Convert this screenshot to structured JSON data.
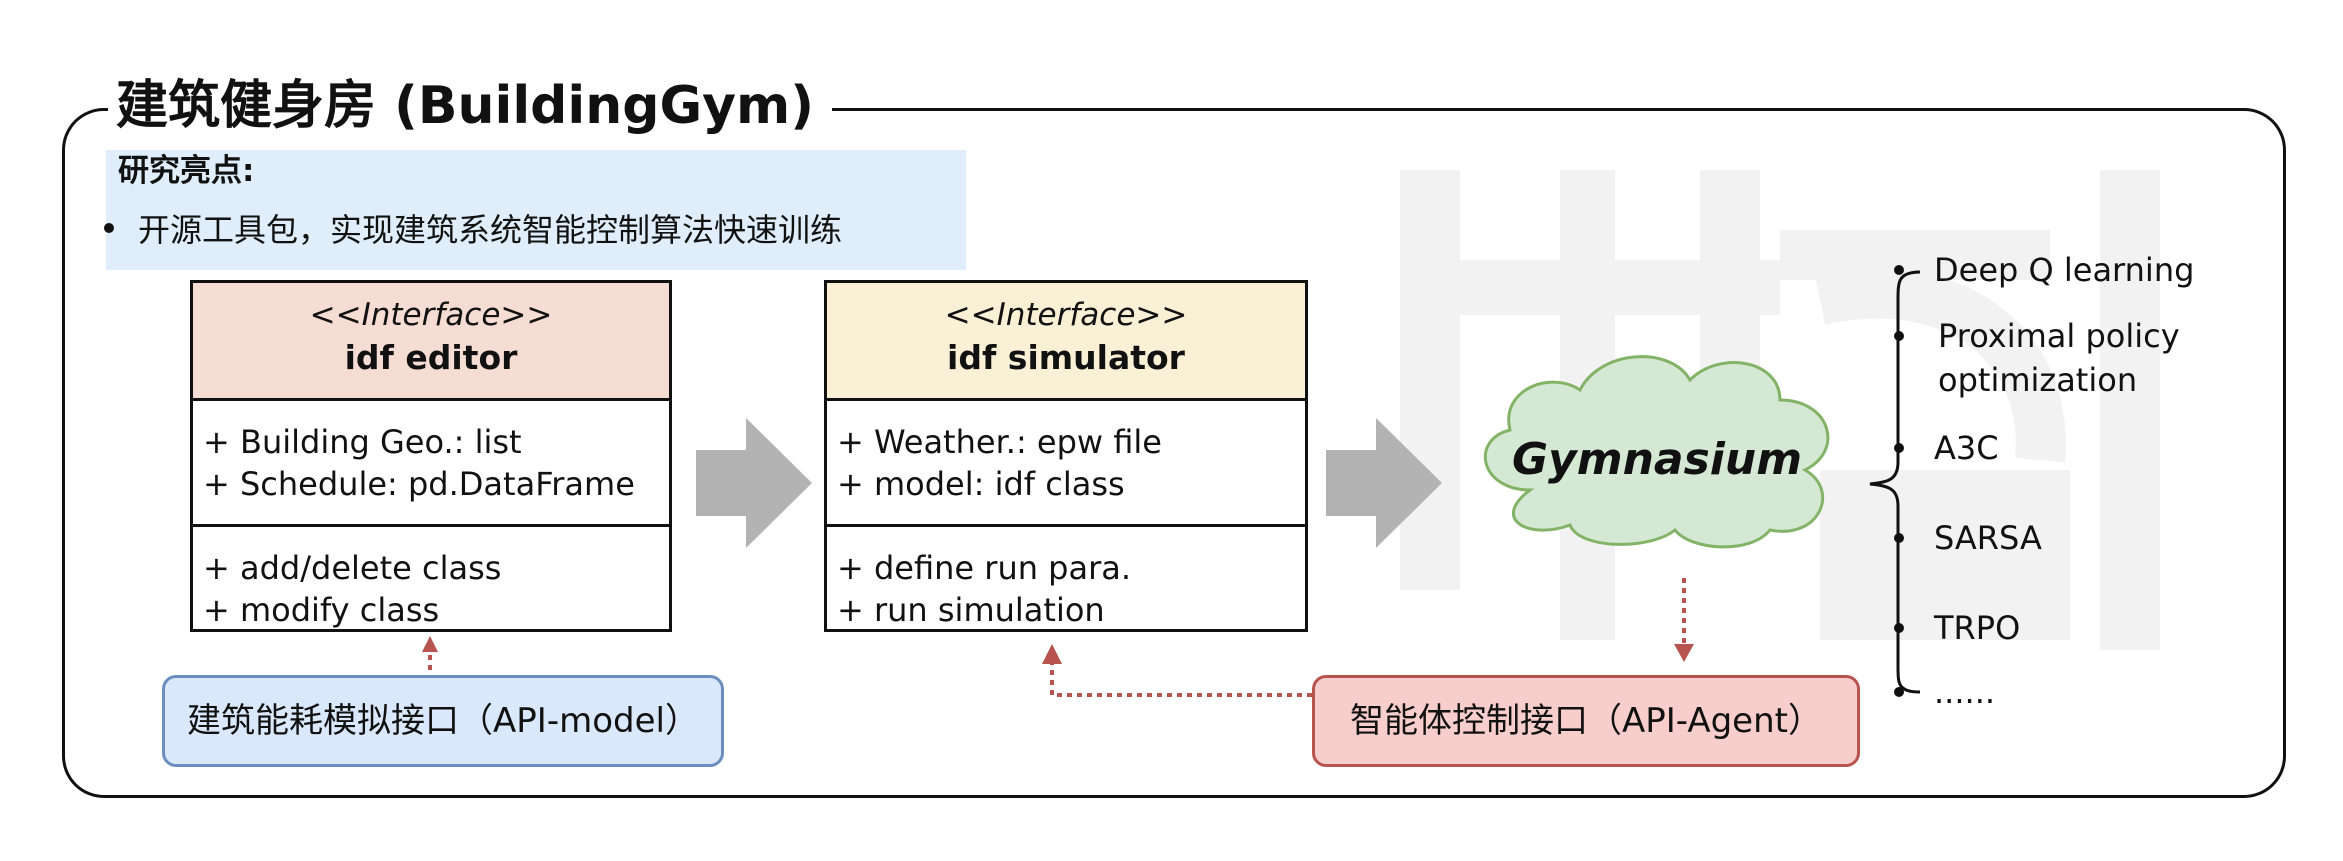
{
  "diagram": {
    "title": "建筑健身房 (BuildingGym)",
    "highlights": {
      "heading": "研究亮点:",
      "bullet": "开源工具包，实现建筑系统智能控制算法快速训练"
    },
    "editor": {
      "stereotype": "<<Interface>>",
      "name": "idf editor",
      "attributes": [
        "+ Building Geo.: list",
        "+ Schedule: pd.DataFrame"
      ],
      "operations": [
        "+ add/delete class",
        "+ modify class"
      ],
      "header_color": "#f5ddd3"
    },
    "simulator": {
      "stereotype": "<<Interface>>",
      "name": "idf simulator",
      "attributes": [
        "+ Weather.: epw file",
        "+ model: idf class"
      ],
      "operations": [
        "+ define run para.",
        "+ run simulation"
      ],
      "header_color": "#f9f0d6"
    },
    "cloud_label": "Gymnasium",
    "api_model": "建筑能耗模拟接口（API-model）",
    "api_agent": "智能体控制接口（API-Agent）",
    "algorithms": [
      "Deep Q learning",
      "Proximal policy",
      "optimization",
      "A3C",
      "SARSA",
      "TRPO",
      "......"
    ],
    "colors": {
      "cloud_fill": "#d5e8d4",
      "cloud_stroke": "#82b366",
      "arrow_gray": "#b3b3b3",
      "dotted_red": "#b85450"
    }
  }
}
